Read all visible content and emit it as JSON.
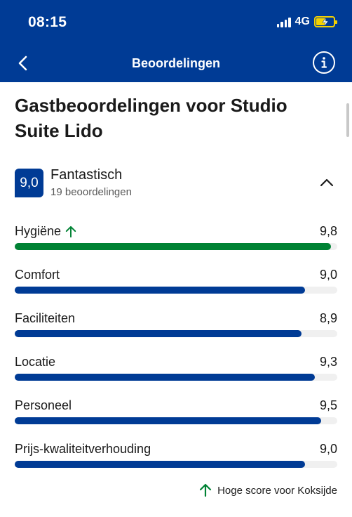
{
  "status_bar": {
    "time": "08:15",
    "network": "4G"
  },
  "nav": {
    "title": "Beoordelingen",
    "back_icon": "chevron-left-icon",
    "info_icon": "info-icon"
  },
  "title": "Gastbeoordelingen voor Studio Suite Lido",
  "overall": {
    "score": "9,0",
    "label": "Fantastisch",
    "count": "19 beoordelingen"
  },
  "categories": [
    {
      "label": "Hygiëne",
      "value": "9,8",
      "score": 9.8,
      "high": true
    },
    {
      "label": "Comfort",
      "value": "9,0",
      "score": 9.0,
      "high": false
    },
    {
      "label": "Faciliteiten",
      "value": "8,9",
      "score": 8.9,
      "high": false
    },
    {
      "label": "Locatie",
      "value": "9,3",
      "score": 9.3,
      "high": false
    },
    {
      "label": "Personeel",
      "value": "9,5",
      "score": 9.5,
      "high": false
    },
    {
      "label": "Prijs-kwaliteitverhouding",
      "value": "9,0",
      "score": 9.0,
      "high": false
    }
  ],
  "footer_note": "Hoge score voor Koksijde",
  "colors": {
    "brand": "#003b95",
    "high": "#008234",
    "track": "#f0f0f0"
  }
}
